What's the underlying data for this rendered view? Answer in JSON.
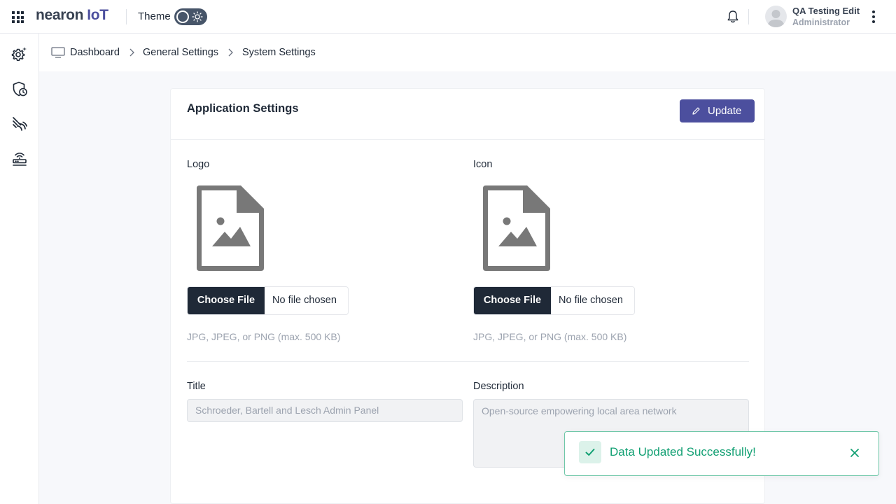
{
  "header": {
    "logo_main": "nearon",
    "logo_accent": "IoT",
    "theme_label": "Theme",
    "user_name": "QA Testing Edit",
    "user_role": "Administrator"
  },
  "sidebar": {
    "items": [
      {
        "icon": "settings-gear-icon"
      },
      {
        "icon": "shield-clock-icon"
      },
      {
        "icon": "signal-waves-icon"
      },
      {
        "icon": "router-device-icon"
      }
    ]
  },
  "breadcrumb": {
    "items": [
      "Dashboard",
      "General Settings",
      "System Settings"
    ]
  },
  "card": {
    "title": "Application Settings",
    "update_label": "Update",
    "logo": {
      "label": "Logo",
      "choose_file": "Choose File",
      "status": "No file chosen",
      "hint": "JPG, JPEG, or PNG (max. 500 KB)"
    },
    "icon": {
      "label": "Icon",
      "choose_file": "Choose File",
      "status": "No file chosen",
      "hint": "JPG, JPEG, or PNG (max. 500 KB)"
    },
    "title_field": {
      "label": "Title",
      "placeholder": "Schroeder, Bartell and Lesch Admin Panel"
    },
    "description_field": {
      "label": "Description",
      "placeholder": "Open-source empowering local area network"
    }
  },
  "toast": {
    "message": "Data Updated Successfully!"
  },
  "colors": {
    "accent": "#4c4f9e",
    "success": "#12a073",
    "dark_button": "#1f2937"
  }
}
